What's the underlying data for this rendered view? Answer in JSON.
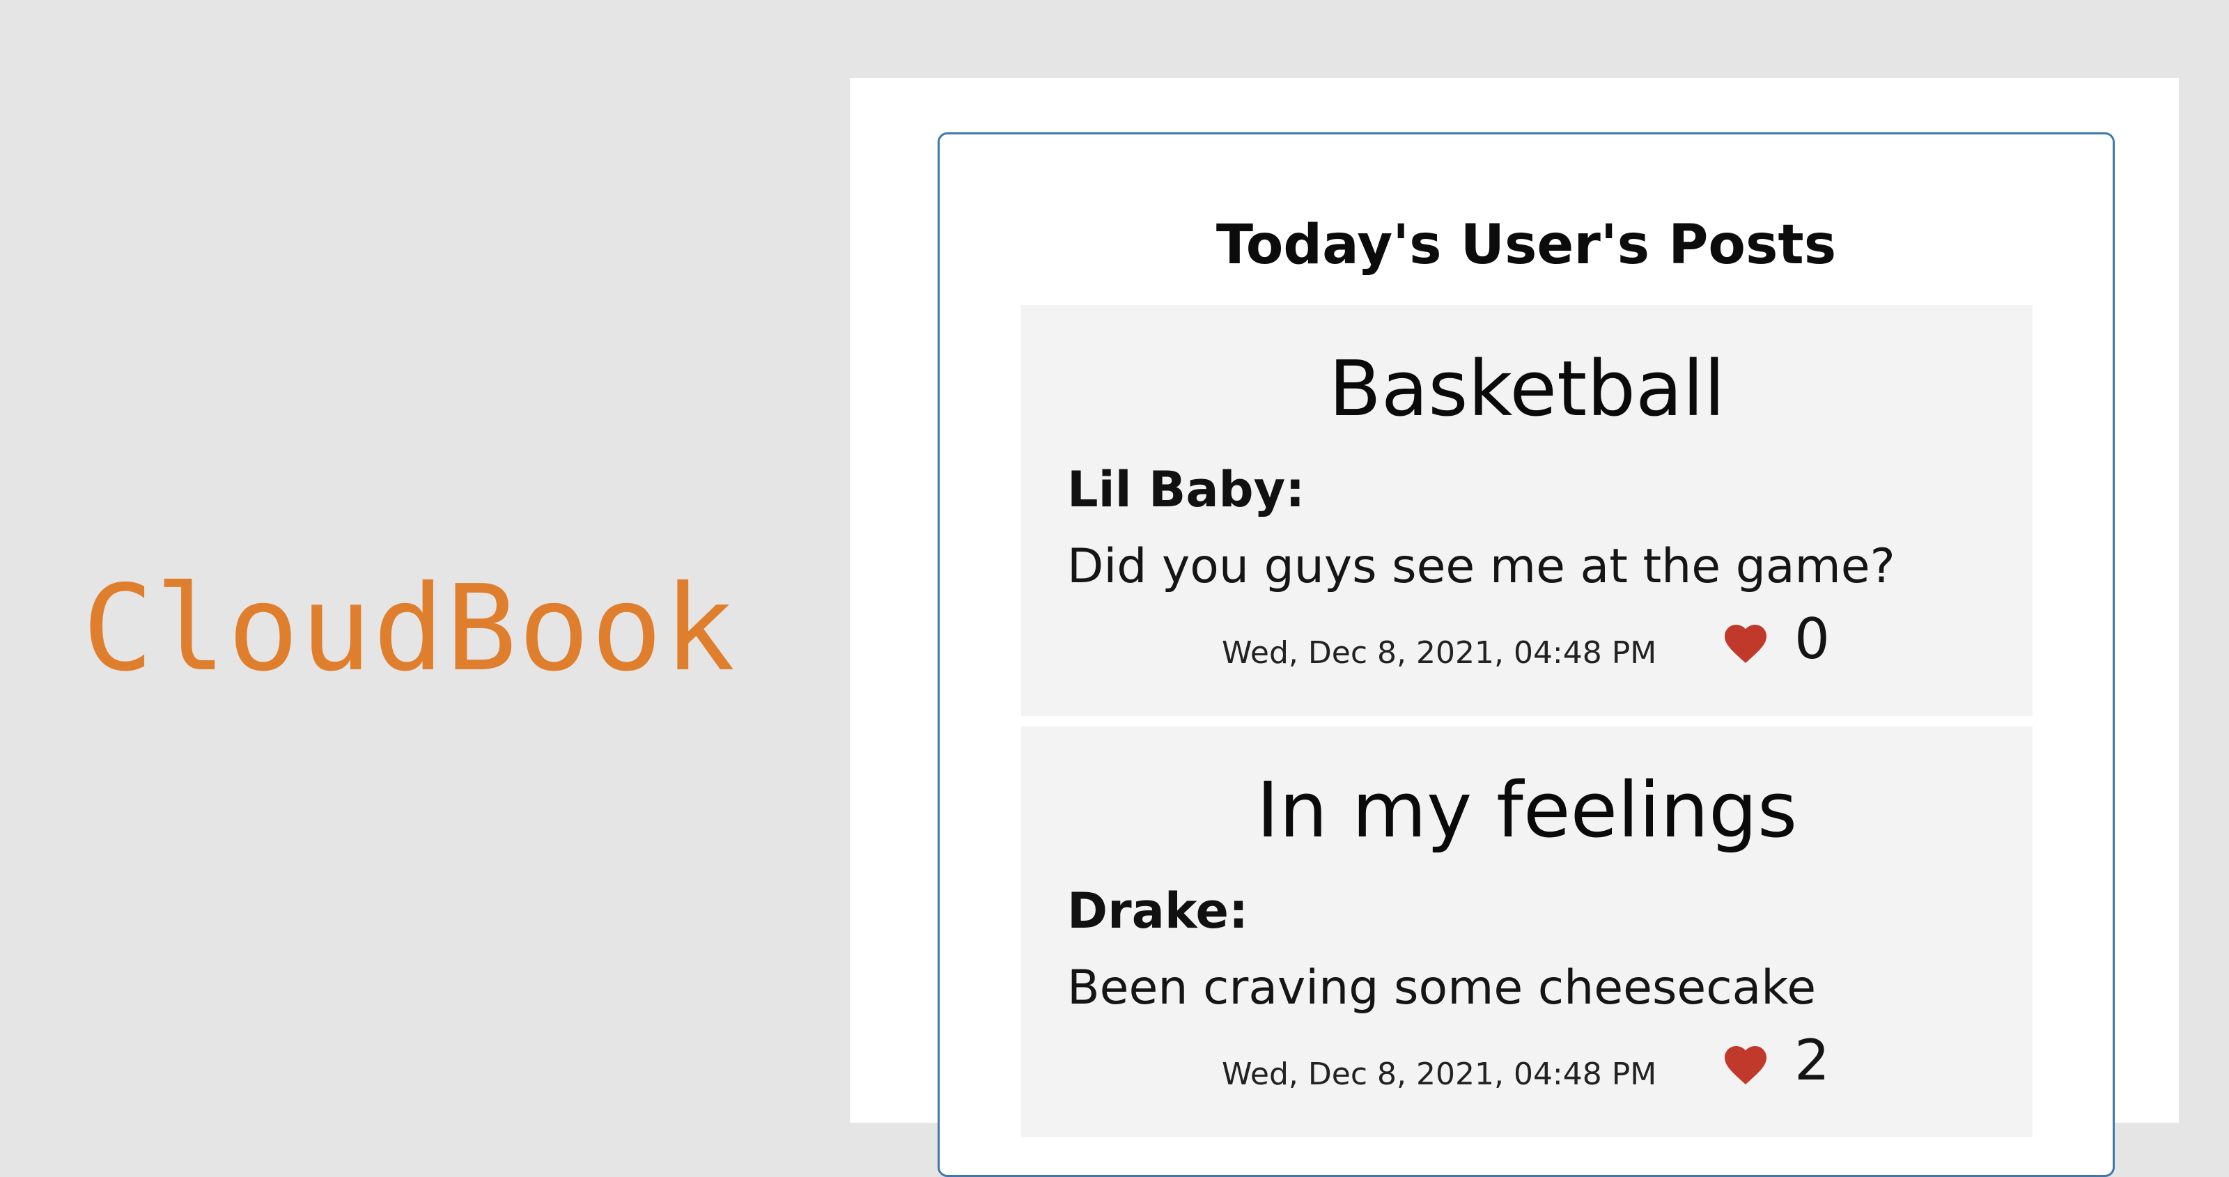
{
  "app": {
    "logo_text": "CloudBook",
    "accent_color": "#df7f2e"
  },
  "feed": {
    "title": "Today's User's Posts",
    "border_color": "#3f78ac",
    "posts": [
      {
        "title": "Basketball",
        "author": "Lil Baby:",
        "body": "Did you guys see me at the game?",
        "timestamp": "Wed, Dec 8, 2021, 04:48 PM",
        "likes": "0",
        "like_icon": "heart-icon",
        "like_color": "#c0392b"
      },
      {
        "title": "In my feelings",
        "author": "Drake:",
        "body": "Been craving some cheesecake",
        "timestamp": "Wed, Dec 8, 2021, 04:48 PM",
        "likes": "2",
        "like_icon": "heart-icon",
        "like_color": "#c0392b"
      }
    ]
  }
}
